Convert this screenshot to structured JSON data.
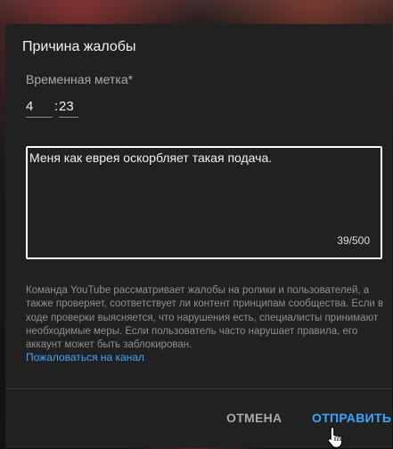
{
  "dialog": {
    "title": "Причина жалобы",
    "timestamp": {
      "label": "Временная метка*",
      "minutes": "4",
      "separator": ":",
      "seconds": "23"
    },
    "comment": {
      "value": "Меня как еврея оскорбляет такая подача.",
      "counter": "39/500"
    },
    "notice": "Команда YouTube рассматривает жалобы на ролики и пользователей, а также проверяет, соответствует ли контент принципам сообщества. Если в ходе проверки выясняется, что нарушения есть, специалисты принимают необходимые меры. Если пользователь часто нарушает правила, его аккаунт может быть заблокирован.",
    "report_channel_link": "Пожаловаться на канал",
    "buttons": {
      "cancel": "ОТМЕНА",
      "submit": "ОТПРАВИТЬ"
    }
  },
  "colors": {
    "dialog_bg": "#212121",
    "accent": "#3ea6ff",
    "text_primary": "#f1f1f1",
    "text_secondary": "#aaaaaa"
  },
  "icons": {
    "cursor": "hand-pointer-icon"
  }
}
